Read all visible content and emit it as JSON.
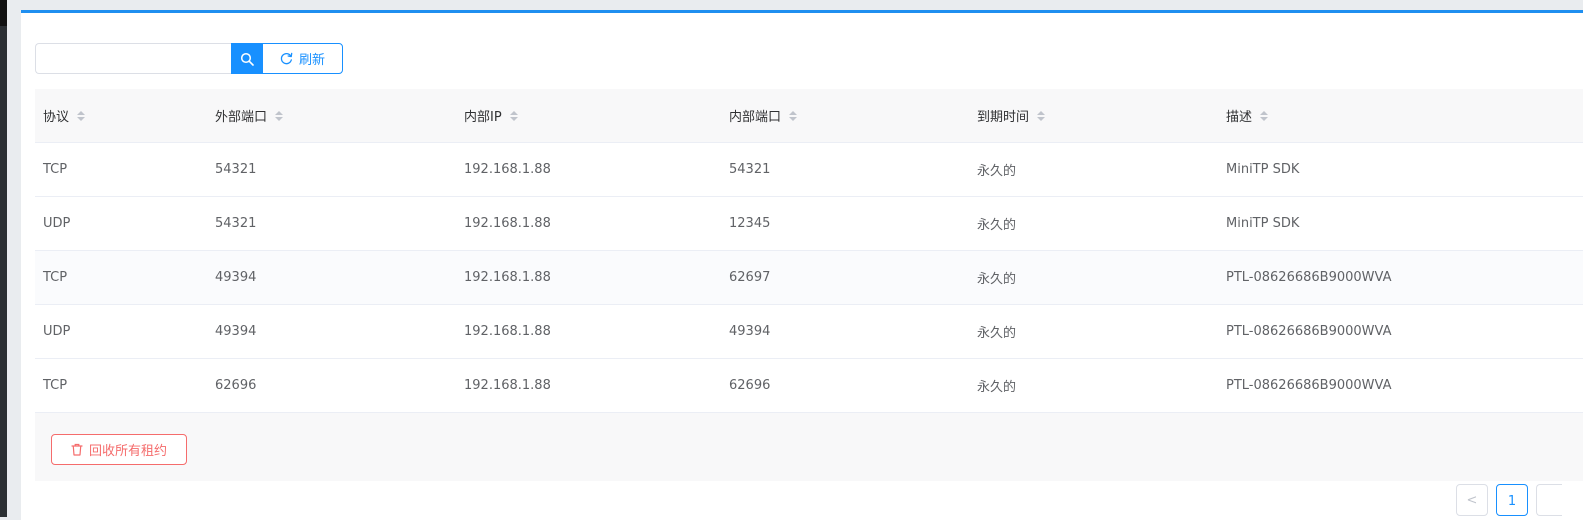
{
  "toolbar": {
    "search_placeholder": "",
    "search_value": "",
    "refresh_label": "刷新"
  },
  "table": {
    "headers": [
      "协议",
      "外部端口",
      "内部IP",
      "内部端口",
      "到期时间",
      "描述"
    ],
    "rows": [
      [
        "TCP",
        "54321",
        "192.168.1.88",
        "54321",
        "永久的",
        "MiniTP SDK"
      ],
      [
        "UDP",
        "54321",
        "192.168.1.88",
        "12345",
        "永久的",
        "MiniTP SDK"
      ],
      [
        "TCP",
        "49394",
        "192.168.1.88",
        "62697",
        "永久的",
        "PTL-08626686B9000WVA"
      ],
      [
        "UDP",
        "49394",
        "192.168.1.88",
        "49394",
        "永久的",
        "PTL-08626686B9000WVA"
      ],
      [
        "TCP",
        "62696",
        "192.168.1.88",
        "62696",
        "永久的",
        "PTL-08626686B9000WVA"
      ]
    ]
  },
  "footer": {
    "revoke_label": "回收所有租约"
  },
  "pagination": {
    "prev_label": "<",
    "current_page": "1"
  },
  "colors": {
    "accent": "#1890ff",
    "danger": "#f56c6c",
    "top_bar": "#1f8ff0"
  },
  "icons": {
    "search": "search-icon",
    "refresh": "refresh-icon",
    "trash": "trash-icon",
    "sort": "sort-icon"
  }
}
